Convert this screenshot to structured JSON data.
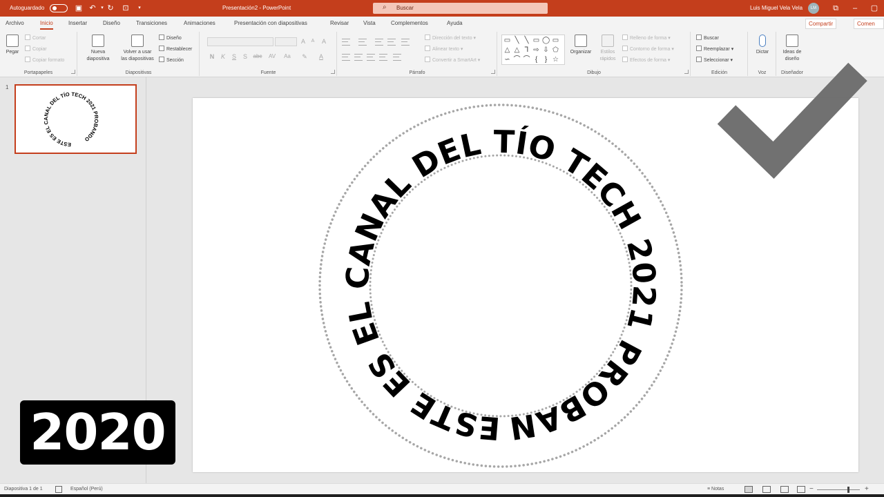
{
  "titlebar": {
    "autosave_label": "Autoguardado",
    "document_title": "Presentación2  -  PowerPoint",
    "search_placeholder": "Buscar",
    "user_name": "Luis Miguel Vela Vela",
    "user_initials": "LM"
  },
  "tabs": [
    {
      "label": "Archivo"
    },
    {
      "label": "Inicio",
      "active": true
    },
    {
      "label": "Insertar"
    },
    {
      "label": "Diseño"
    },
    {
      "label": "Transiciones"
    },
    {
      "label": "Animaciones"
    },
    {
      "label": "Presentación con diapositivas"
    },
    {
      "label": "Revisar"
    },
    {
      "label": "Vista"
    },
    {
      "label": "Complementos"
    },
    {
      "label": "Ayuda"
    }
  ],
  "share_label": "Compartir",
  "comments_label": "Comen",
  "ribbon": {
    "portapapeles": {
      "label": "Portapapeles",
      "paste": "Pegar",
      "cut": "Cortar",
      "copy": "Copiar",
      "copy_format": "Copiar formato"
    },
    "diapositivas": {
      "label": "Diapositivas",
      "new_slide_1": "Nueva",
      "new_slide_2": "diapositiva",
      "reuse_1": "Volver a usar",
      "reuse_2": "las diapositivas",
      "layout": "Diseño",
      "reset": "Restablecer",
      "section": "Sección"
    },
    "fuente": {
      "label": "Fuente",
      "buttons": [
        "N",
        "K",
        "S",
        "S",
        "abc",
        "AV",
        "Aa"
      ]
    },
    "parrafo": {
      "label": "Párrafo",
      "text_direction": "Dirección del texto",
      "align_text": "Alinear texto",
      "smartart": "Convertir a SmartArt"
    },
    "dibujo": {
      "label": "Dibujo",
      "arrange": "Organizar",
      "quick_styles_1": "Estilos",
      "quick_styles_2": "rápidos",
      "shape_fill": "Relleno de forma",
      "shape_outline": "Contorno de forma",
      "shape_effects": "Efectos de forma"
    },
    "edicion": {
      "label": "Edición",
      "find": "Buscar",
      "replace": "Reemplazar",
      "select": "Seleccionar"
    },
    "voz": {
      "label": "Voz",
      "dictate": "Dictar"
    },
    "disenador": {
      "label": "Diseñador",
      "ideas_1": "Ideas de",
      "ideas_2": "diseño"
    }
  },
  "thumbnail": {
    "number": "1"
  },
  "slide": {
    "circular_text": "ESTE ES EL CANAL DEL TÍO TECH 2021 PROBANDO"
  },
  "overlay": {
    "badge_year": "2020"
  },
  "statusbar": {
    "slide_info": "Diapositiva 1 de 1",
    "language": "Español (Perú)",
    "notes": "Notas"
  },
  "colors": {
    "accent": "#c43e1c",
    "checkmark": "#6e6e6e",
    "dotted_ring": "#a6a6a6"
  }
}
